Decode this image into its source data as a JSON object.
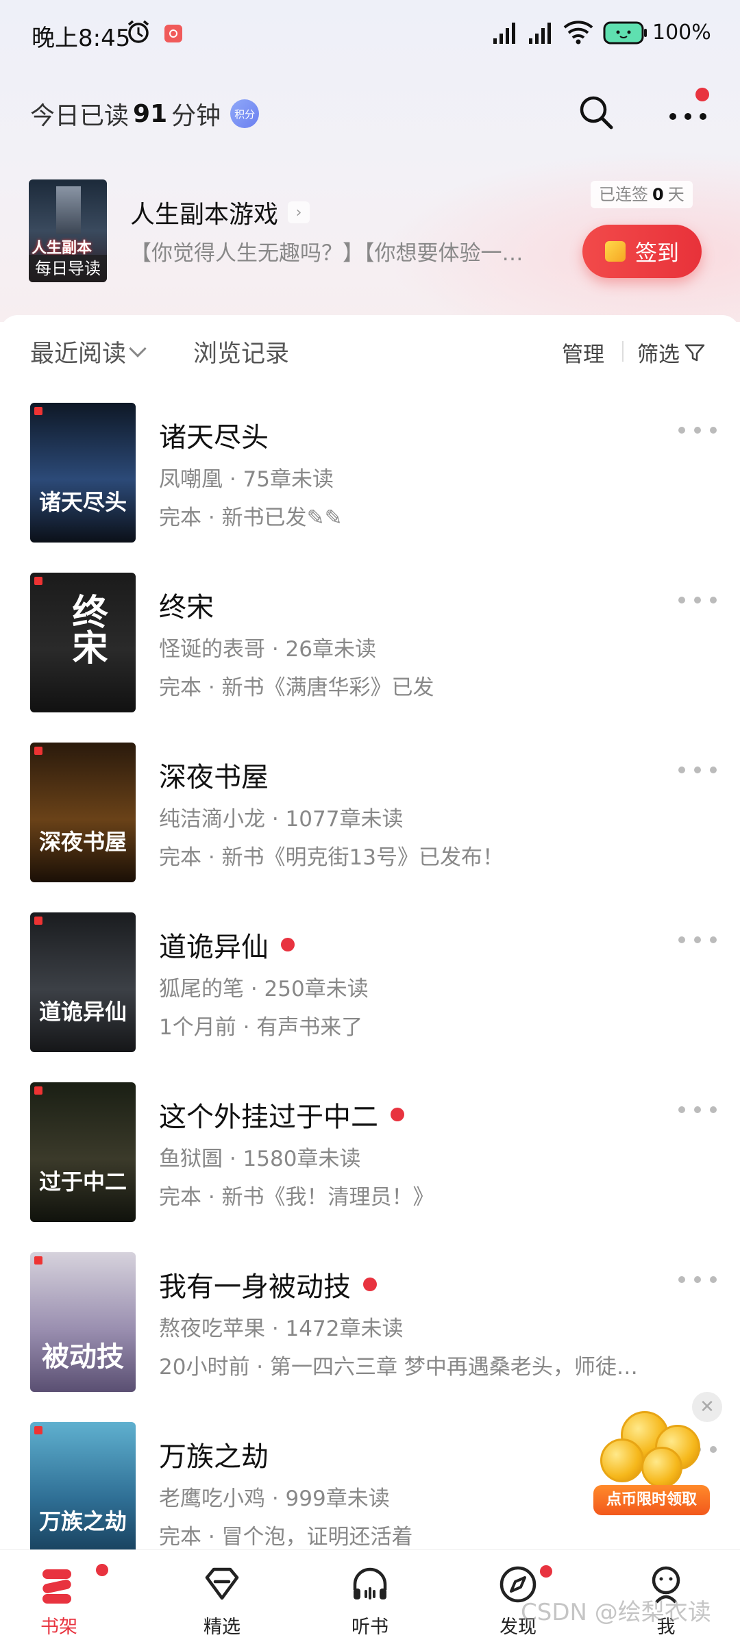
{
  "status_bar": {
    "time": "晚上8:45",
    "battery": "100%"
  },
  "header": {
    "read_prefix": "今日已读",
    "read_minutes": "91",
    "read_suffix": "分钟",
    "points_badge": "积分"
  },
  "guide": {
    "cover_title": "人生副本",
    "cover_band": "每日导读",
    "title": "人生副本游戏",
    "subtitle": "【你觉得人生无趣吗？】【你想要体验一…",
    "streak_prefix": "已连签",
    "streak_days": "0",
    "streak_suffix": "天",
    "signin_label": "签到"
  },
  "filters": {
    "recent_label": "最近阅读",
    "history_label": "浏览记录",
    "manage_label": "管理",
    "filter_label": "筛选"
  },
  "books": [
    {
      "title": "诸天尽头",
      "meta": "凤嘲凰 · 75章未读",
      "update": "完本 · 新书已发✎✎",
      "new": false,
      "cover_text": "诸天尽头",
      "cover_colors": [
        "#0e1826",
        "#2c4a78",
        "#0b1018"
      ]
    },
    {
      "title": "终宋",
      "meta": "怪诞的表哥 · 26章未读",
      "update": "完本 · 新书《满唐华彩》已发",
      "new": false,
      "cover_text": "终宋",
      "cover_colors": [
        "#1b1b1b",
        "#2a2a2a",
        "#111111"
      ]
    },
    {
      "title": "深夜书屋",
      "meta": "纯洁滴小龙 · 1077章未读",
      "update": "完本 · 新书《明克街13号》已发布！",
      "new": false,
      "cover_text": "深夜书屋",
      "cover_colors": [
        "#2a1a0c",
        "#6a4218",
        "#1a0f06"
      ]
    },
    {
      "title": "道诡异仙",
      "meta": "狐尾的笔 · 250章未读",
      "update": "1个月前 · 有声书来了",
      "new": true,
      "cover_text": "道诡异仙",
      "cover_colors": [
        "#1a1c1f",
        "#3c4046",
        "#151618"
      ]
    },
    {
      "title": "这个外挂过于中二",
      "meta": "鱼狱圄 · 1580章未读",
      "update": "完本 · 新书《我！清理员！》",
      "new": true,
      "cover_text": "过于中二",
      "cover_colors": [
        "#1a1f14",
        "#3b3a2a",
        "#10120c"
      ]
    },
    {
      "title": "我有一身被动技",
      "meta": "熬夜吃苹果 · 1472章未读",
      "update": "20小时前 · 第一四六三章 梦中再遇桑老头，师徒…",
      "new": true,
      "cover_text": "被动技",
      "cover_colors": [
        "#d6d2dc",
        "#9a8fb0",
        "#5a4f72"
      ]
    },
    {
      "title": "万族之劫",
      "meta": "老鹰吃小鸡 · 999章未读",
      "update": "完本 · 冒个泡，证明还活着",
      "new": false,
      "cover_text": "万族之劫",
      "cover_colors": [
        "#5fb0cf",
        "#2f6f95",
        "#153a55"
      ]
    }
  ],
  "promo": {
    "label": "点币限时领取",
    "close_glyph": "✕"
  },
  "nav": [
    {
      "label": "书架",
      "icon": "bookshelf-icon",
      "active": true
    },
    {
      "label": "精选",
      "icon": "diamond-icon",
      "active": false
    },
    {
      "label": "听书",
      "icon": "headphones-icon",
      "active": false
    },
    {
      "label": "发现",
      "icon": "compass-icon",
      "active": false
    },
    {
      "label": "我",
      "icon": "profile-icon",
      "active": false
    }
  ],
  "watermark": "CSDN @绘梨衣读",
  "colors": {
    "accent": "#e8333f",
    "signin_gradient_start": "#f24a4a"
  }
}
